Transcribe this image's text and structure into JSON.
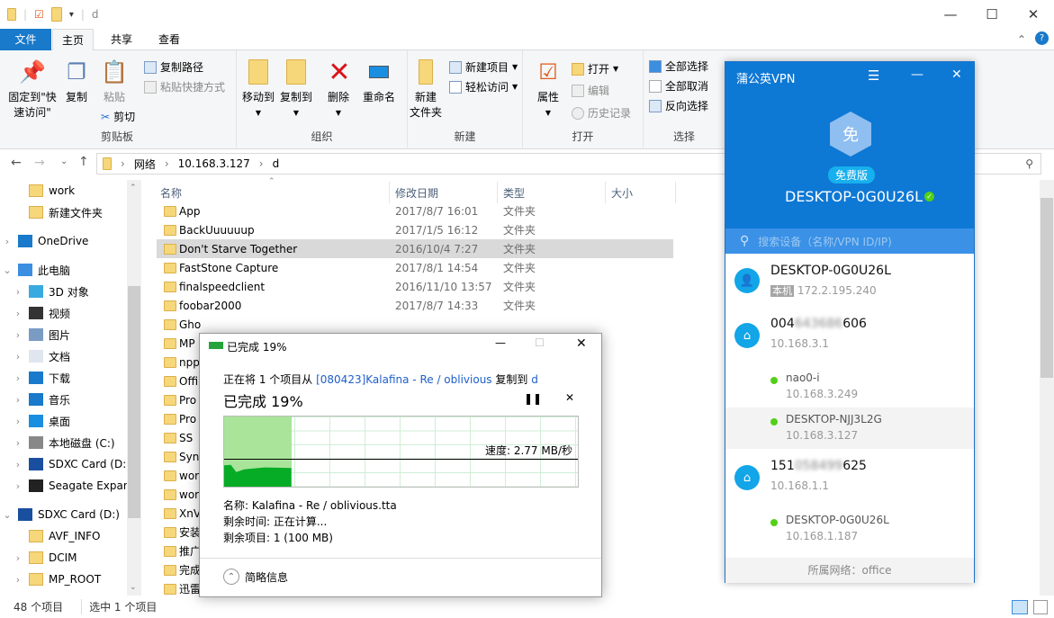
{
  "window": {
    "title": "d"
  },
  "ribbon_tabs": [
    "文件",
    "主页",
    "共享",
    "查看"
  ],
  "ribbon": {
    "clipboard": {
      "pin": "固定到\"快\n速访问\"",
      "copy": "复制",
      "paste": "粘贴",
      "copy_path": "复制路径",
      "paste_shortcut": "粘贴快捷方式",
      "cut": "剪切",
      "label": "剪贴板"
    },
    "organize": {
      "move_to": "移动到",
      "copy_to": "复制到",
      "delete": "删除",
      "rename": "重命名",
      "label": "组织"
    },
    "new": {
      "new_folder": "新建\n文件夹",
      "new_item": "新建项目",
      "easy_access": "轻松访问",
      "label": "新建"
    },
    "open": {
      "properties": "属性",
      "open": "打开",
      "edit": "编辑",
      "history": "历史记录",
      "label": "打开"
    },
    "select": {
      "select_all": "全部选择",
      "select_none": "全部取消",
      "invert": "反向选择",
      "label": "选择"
    }
  },
  "address": {
    "crumbs": [
      "网络",
      "10.168.3.127",
      "d"
    ]
  },
  "nav": [
    {
      "label": "work",
      "indent": 1,
      "icon": "folder"
    },
    {
      "label": "新建文件夹",
      "indent": 1,
      "icon": "folder"
    },
    {
      "label": "OneDrive",
      "indent": 0,
      "icon": "cloud",
      "chev": "›"
    },
    {
      "label": "此电脑",
      "indent": 0,
      "icon": "pc",
      "chev": "⌄"
    },
    {
      "label": "3D 对象",
      "indent": 1,
      "icon": "3d",
      "chev": "›"
    },
    {
      "label": "视频",
      "indent": 1,
      "icon": "video",
      "chev": "›"
    },
    {
      "label": "图片",
      "indent": 1,
      "icon": "pictures",
      "chev": "›"
    },
    {
      "label": "文档",
      "indent": 1,
      "icon": "documents",
      "chev": "›"
    },
    {
      "label": "下载",
      "indent": 1,
      "icon": "download",
      "chev": "›"
    },
    {
      "label": "音乐",
      "indent": 1,
      "icon": "music",
      "chev": "›"
    },
    {
      "label": "桌面",
      "indent": 1,
      "icon": "desktop",
      "chev": "›"
    },
    {
      "label": "本地磁盘 (C:)",
      "indent": 1,
      "icon": "drive",
      "chev": "›"
    },
    {
      "label": "SDXC Card (D:)",
      "indent": 1,
      "icon": "sdcard",
      "chev": "›"
    },
    {
      "label": "Seagate Expan",
      "indent": 1,
      "icon": "hdd",
      "chev": "›"
    },
    {
      "label": "SDXC Card (D:)",
      "indent": 0,
      "icon": "sdcard",
      "chev": "⌄"
    },
    {
      "label": "AVF_INFO",
      "indent": 1,
      "icon": "folder"
    },
    {
      "label": "DCIM",
      "indent": 1,
      "icon": "folder",
      "chev": "›"
    },
    {
      "label": "MP_ROOT",
      "indent": 1,
      "icon": "folder",
      "chev": "›"
    }
  ],
  "columns": [
    "名称",
    "修改日期",
    "类型",
    "大小"
  ],
  "files": [
    {
      "name": "App",
      "date": "2017/8/7 16:01",
      "type": "文件夹"
    },
    {
      "name": "BackUuuuuup",
      "date": "2017/1/5 16:12",
      "type": "文件夹"
    },
    {
      "name": "Don't Starve Together",
      "date": "2016/10/4 7:27",
      "type": "文件夹",
      "selected": true
    },
    {
      "name": "FastStone Capture",
      "date": "2017/8/1 14:54",
      "type": "文件夹"
    },
    {
      "name": "finalspeedclient",
      "date": "2016/11/10 13:57",
      "type": "文件夹"
    },
    {
      "name": "foobar2000",
      "date": "2017/8/7 14:33",
      "type": "文件夹"
    },
    {
      "name": "Gho"
    },
    {
      "name": "MP"
    },
    {
      "name": "npp"
    },
    {
      "name": "Offi"
    },
    {
      "name": "Pro"
    },
    {
      "name": "Pro"
    },
    {
      "name": "SS"
    },
    {
      "name": "Syn"
    },
    {
      "name": "wor"
    },
    {
      "name": "wor"
    },
    {
      "name": "XnV"
    },
    {
      "name": "安装"
    },
    {
      "name": "推广"
    },
    {
      "name": "完成"
    },
    {
      "name": "迅雷"
    }
  ],
  "status": {
    "count": "48 个项目",
    "selected": "选中 1 个项目"
  },
  "copy_dialog": {
    "title": "已完成 19%",
    "line_prefix": "正在将 1 个项目从 ",
    "source": "[080423]Kalafina - Re / oblivious",
    "line_mid": " 复制到 ",
    "dest": "d",
    "progress_text": "已完成 19%",
    "progress_percent": 19,
    "speed": "速度: 2.77 MB/秒",
    "name": "名称: Kalafina - Re / oblivious.tta",
    "time_left": "剩余时间: 正在计算...",
    "items_left": "剩余项目: 1 (100 MB)",
    "less_details": "简略信息"
  },
  "vpn": {
    "title": "蒲公英VPN",
    "badge_char": "免",
    "edition": "免费版",
    "device": "DESKTOP-0G0U26L",
    "search_placeholder": "搜索设备（名称/VPN ID/IP)",
    "self": {
      "name": "DESKTOP-0G0U26L",
      "tag": "本机",
      "ip": "172.2.195.240"
    },
    "groups": [
      {
        "id_prefix": "004",
        "id_hidden": "643686",
        "id_suffix": "606",
        "ip": "10.168.3.1",
        "members": [
          {
            "name": "nao0-i",
            "ip": "10.168.3.249"
          },
          {
            "name": "DESKTOP-NJJ3L2G",
            "ip": "10.168.3.127"
          }
        ]
      },
      {
        "id_prefix": "151",
        "id_hidden": "058499",
        "id_suffix": "625",
        "ip": "10.168.1.1",
        "members": [
          {
            "name": "DESKTOP-0G0U26L",
            "ip": "10.168.1.187"
          }
        ]
      }
    ],
    "footer": "所属网络：office"
  },
  "colors": {
    "accent": "#1979ca",
    "vpn_blue": "#0e78d5",
    "online": "#52d017",
    "progress": "#06ab26"
  }
}
